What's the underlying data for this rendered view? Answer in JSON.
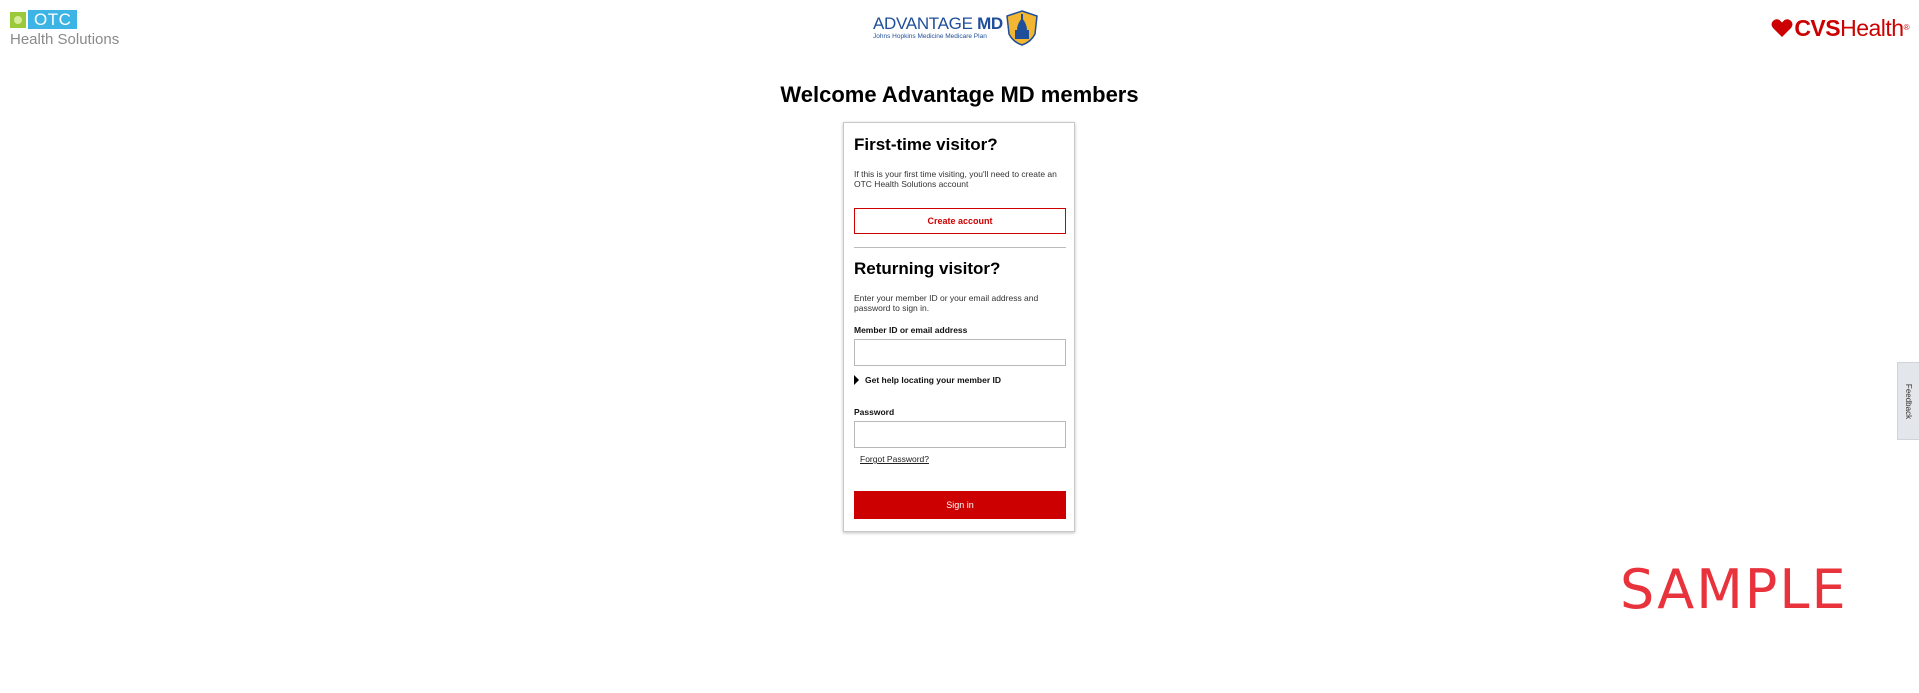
{
  "header": {
    "otc_logo": {
      "badge_text": "OTC",
      "subtitle": "Health Solutions"
    },
    "plan_logo": {
      "title_prefix": "ADVANTAGE ",
      "title_suffix": "MD",
      "subtitle": "Johns Hopkins Medicine Medicare Plan"
    },
    "cvs_logo": {
      "brand": "CVS",
      "suffix": "Health",
      "reg_mark": "®"
    }
  },
  "main": {
    "title": "Welcome Advantage MD members"
  },
  "first_time": {
    "title": "First-time visitor?",
    "description": "If this is your first time visiting, you'll need to create an OTC Health Solutions account",
    "create_button": "Create account"
  },
  "returning": {
    "title": "Returning visitor?",
    "description": "Enter your member ID or your email address and password to sign in.",
    "member_label": "Member ID or email address",
    "member_value": "",
    "help_toggle": "Get help locating your member ID",
    "password_label": "Password",
    "password_value": "",
    "forgot_link": "Forgot Password?",
    "signin_button": "Sign in"
  },
  "feedback": {
    "label": "Feedback"
  },
  "watermark": {
    "text": "SAMPLE"
  },
  "colors": {
    "brand_red": "#cc0000",
    "otc_blue": "#3cb4e5",
    "otc_green": "#9ac93b",
    "plan_blue": "#1f4e9a",
    "watermark_red": "#e8323c"
  }
}
